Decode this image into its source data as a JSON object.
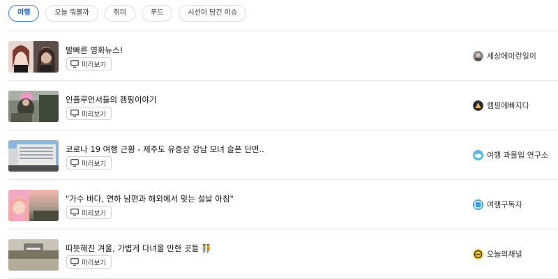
{
  "tabs": [
    {
      "label": "여행",
      "active": true
    },
    {
      "label": "오늘 뭐볼까",
      "active": false
    },
    {
      "label": "취미",
      "active": false
    },
    {
      "label": "푸드",
      "active": false
    },
    {
      "label": "시선이 담긴 이슈",
      "active": false
    }
  ],
  "preview_label": "미리보기",
  "items": [
    {
      "title": "발빠른 영화뉴스!",
      "channel": "세상에이런일이",
      "thumb_icon": "two-portraits-thumbnail",
      "channel_icon": "round-avatar-icon"
    },
    {
      "title": "인플루언서들의 캠핑이야기",
      "channel": "캠핑에빠지다",
      "thumb_icon": "camping-thumbnail",
      "channel_icon": "camping-badge-icon"
    },
    {
      "title": "코로나 19 여행 근황 - 제주도 유증상 강남 모녀 슬픈 단면..",
      "channel": "여행 과몰입 연구소",
      "thumb_icon": "building-thumbnail",
      "channel_icon": "cloud-badge-icon"
    },
    {
      "title": "\"가수 바다, 연하 남편과 해외에서 맞는 설날 아침\"",
      "channel": "여행구독자",
      "thumb_icon": "sunset-portrait-thumbnail",
      "channel_icon": "blue-square-icon"
    },
    {
      "title": "따뜻해진 겨울, 가볍게 다녀올 만한 곳들 🧑‍🤝‍🧑",
      "channel": "오늘의채널",
      "thumb_icon": "plaza-thumbnail",
      "channel_icon": "yellow-face-icon"
    }
  ]
}
